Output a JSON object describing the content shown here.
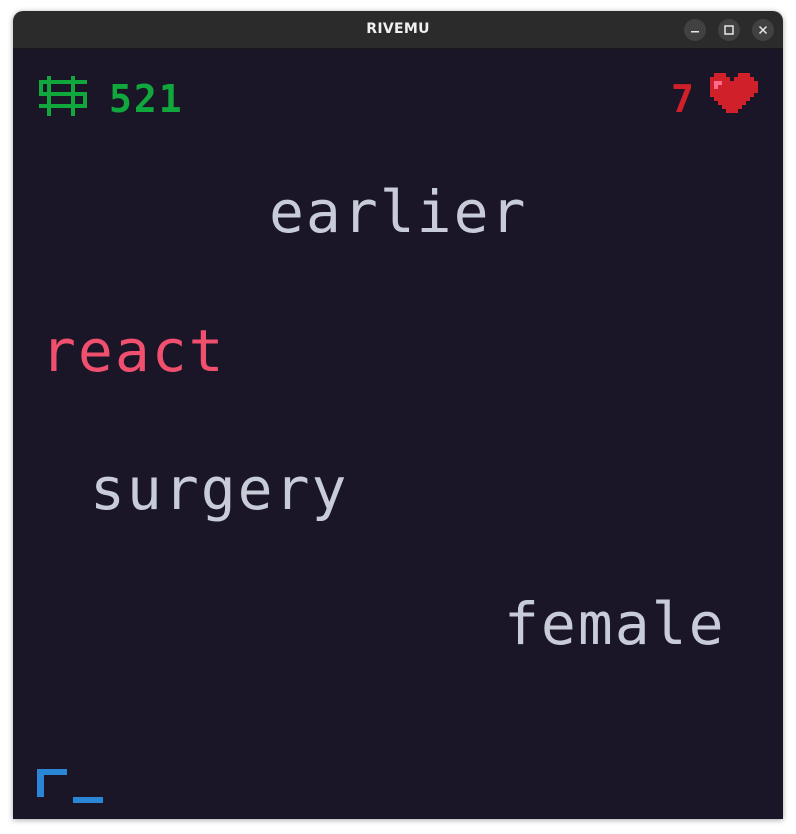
{
  "window": {
    "title": "RIVEMU",
    "controls": [
      "minimize-icon",
      "maximize-icon",
      "close-icon"
    ]
  },
  "hud": {
    "money_icon": "dollar-icon",
    "money": "521",
    "lives": "7",
    "lives_icon": "heart-icon"
  },
  "words": [
    {
      "text": "earlier",
      "state": "normal"
    },
    {
      "text": "react",
      "state": "targeted"
    },
    {
      "text": "surgery",
      "state": "normal"
    },
    {
      "text": "female",
      "state": "normal"
    }
  ],
  "input": {
    "typed": "r",
    "cursor": "_"
  },
  "colors": {
    "background": "#1a1627",
    "money": "#10a83c",
    "lives": "#d0202a",
    "word": "#c8ccd8",
    "targeted_word": "#f0506e",
    "input": "#2a86d6",
    "titlebar": "#2b2b2b"
  }
}
